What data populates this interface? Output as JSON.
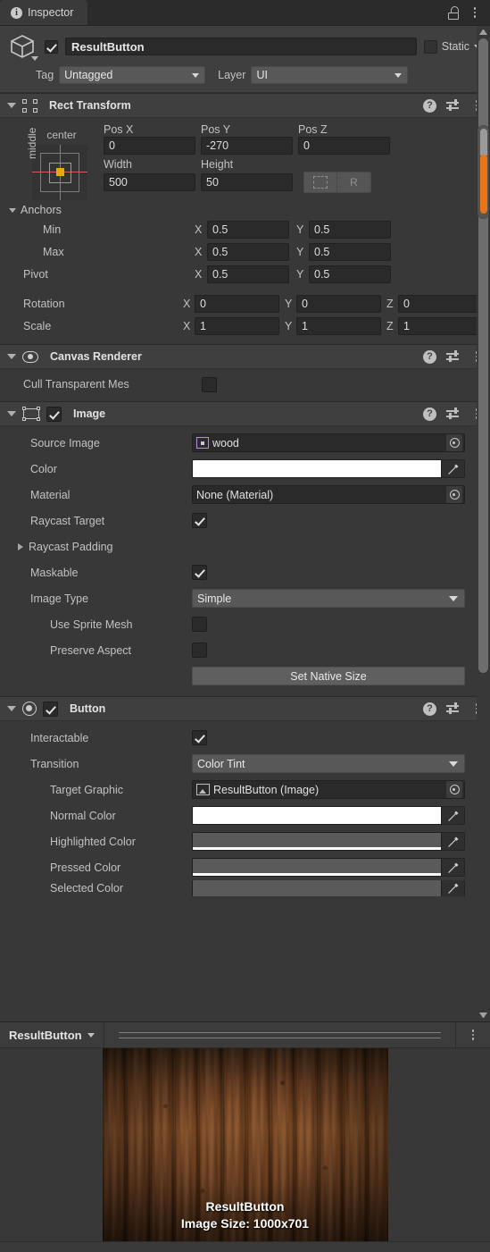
{
  "window": {
    "tab_label": "Inspector",
    "tab_icon": "info-icon",
    "lock_icon": "lock-open-icon",
    "menu_icon": "kebab-menu-icon"
  },
  "object_header": {
    "enabled_checkbox": true,
    "name": "ResultButton",
    "static_label": "Static",
    "static_checked": false,
    "tag_label": "Tag",
    "tag_value": "Untagged",
    "layer_label": "Layer",
    "layer_value": "UI"
  },
  "components": [
    {
      "title": "Rect Transform",
      "icon": "rect-transform-icon",
      "expanded": true,
      "has_enable_checkbox": false
    },
    {
      "title": "Canvas Renderer",
      "icon": "eye-icon",
      "expanded": true,
      "has_enable_checkbox": false
    },
    {
      "title": "Image",
      "icon": "image-component-icon",
      "expanded": true,
      "has_enable_checkbox": true,
      "enabled": true
    },
    {
      "title": "Button",
      "icon": "button-component-icon",
      "expanded": true,
      "has_enable_checkbox": true,
      "enabled": true
    }
  ],
  "rect_transform": {
    "anchor_preset": {
      "horizontal": "center",
      "vertical": "middle"
    },
    "pos_x_label": "Pos X",
    "pos_y_label": "Pos Y",
    "pos_z_label": "Pos Z",
    "pos_x": "0",
    "pos_y": "-270",
    "pos_z": "0",
    "width_label": "Width",
    "height_label": "Height",
    "width": "500",
    "height": "50",
    "blueprint_button": "blueprint-mode-icon",
    "raw_button": "R",
    "anchors_label": "Anchors",
    "min_label": "Min",
    "max_label": "Max",
    "pivot_label": "Pivot",
    "anchor_min_x": "0.5",
    "anchor_min_y": "0.5",
    "anchor_max_x": "0.5",
    "anchor_max_y": "0.5",
    "pivot_x": "0.5",
    "pivot_y": "0.5",
    "rotation_label": "Rotation",
    "rotation_x": "0",
    "rotation_y": "0",
    "rotation_z": "0",
    "scale_label": "Scale",
    "scale_x": "1",
    "scale_y": "1",
    "scale_z": "1",
    "axis_x": "X",
    "axis_y": "Y",
    "axis_z": "Z"
  },
  "canvas_renderer": {
    "cull_label": "Cull Transparent Mes",
    "cull_checked": false
  },
  "image": {
    "source_image_label": "Source Image",
    "source_image_value": "wood",
    "color_label": "Color",
    "color_value": "#FFFFFF",
    "material_label": "Material",
    "material_value": "None (Material)",
    "raycast_target_label": "Raycast Target",
    "raycast_target_checked": true,
    "raycast_padding_label": "Raycast Padding",
    "maskable_label": "Maskable",
    "maskable_checked": true,
    "image_type_label": "Image Type",
    "image_type_value": "Simple",
    "use_sprite_mesh_label": "Use Sprite Mesh",
    "use_sprite_mesh_checked": false,
    "preserve_aspect_label": "Preserve Aspect",
    "preserve_aspect_checked": false,
    "set_native_size_button": "Set Native Size"
  },
  "button": {
    "interactable_label": "Interactable",
    "interactable_checked": true,
    "transition_label": "Transition",
    "transition_value": "Color Tint",
    "target_graphic_label": "Target Graphic",
    "target_graphic_value": "ResultButton (Image)",
    "normal_color_label": "Normal Color",
    "normal_color_value": "#FFFFFF",
    "highlighted_color_label": "Highlighted Color",
    "highlighted_color_value": "#5A5A5A",
    "pressed_color_label": "Pressed Color",
    "pressed_color_value": "#5A5A5A",
    "selected_color_label": "Selected Color",
    "selected_color_value": "#5A5A5A"
  },
  "preview": {
    "title": "ResultButton",
    "dropdown_icon": "chevron-down-icon",
    "menu_icon": "kebab-menu-icon",
    "overlay_name": "ResultButton",
    "overlay_size": "Image Size: 1000x701"
  },
  "colors": {
    "panel_bg": "#383838",
    "header_bg": "#3f3f3f",
    "field_bg": "#2a2a2a",
    "dropdown_bg": "#585858",
    "accent_orange": "#e8751a",
    "anchor_red": "#d4595b",
    "pivot_yellow": "#e8a90c",
    "text": "#c2c2c2"
  }
}
